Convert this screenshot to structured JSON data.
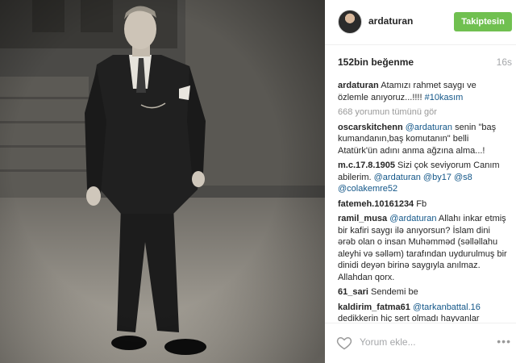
{
  "header": {
    "username": "ardaturan",
    "follow_label": "Takiptesin"
  },
  "stats": {
    "likes": "152bin beğenme",
    "time": "16s"
  },
  "caption": {
    "user": "ardaturan",
    "text": "Atamızı rahmet saygı ve özlemle anıyoruz...!!!! ",
    "hashtag": "#10kasım"
  },
  "view_all": "668 yorumun tümünü gör",
  "comments": [
    {
      "user": "oscarskitchenn",
      "before": " ",
      "mention": "@ardaturan",
      "after": " senin \"baş kumandanın,baş komutanın\" belli Atatürk'ün adını anma ağzına alma...!"
    },
    {
      "user": "m.c.17.8.1905",
      "text": " Sizi çok seviyorum Canım abilerim. ",
      "mentions": "@ardaturan @by17 @s8 @colakemre52"
    },
    {
      "user": "fatemeh.10161234",
      "text": " Fb"
    },
    {
      "user": "ramil_musa",
      "before": " ",
      "mention": "@ardaturan",
      "after": " Allahı inkar etmiş bir kafiri saygı ilə anıyorsun? İslam dini ərəb olan o insan Muhəmməd (səlləllahu aleyhi və səlləm) tarafından uydurulmuş bir dinidi deyən birinə saygıyla anılmaz. Allahdan qorx."
    },
    {
      "user": "61_sari",
      "text": " Sendemi be"
    },
    {
      "user": "kaldirim_fatma61",
      "before": " ",
      "mention": "@tarkanbattal.16",
      "after": " dedikkerin hiç sert olmadı hayvanlar"
    }
  ],
  "footer": {
    "placeholder": "Yorum ekle...",
    "more": "•••"
  }
}
